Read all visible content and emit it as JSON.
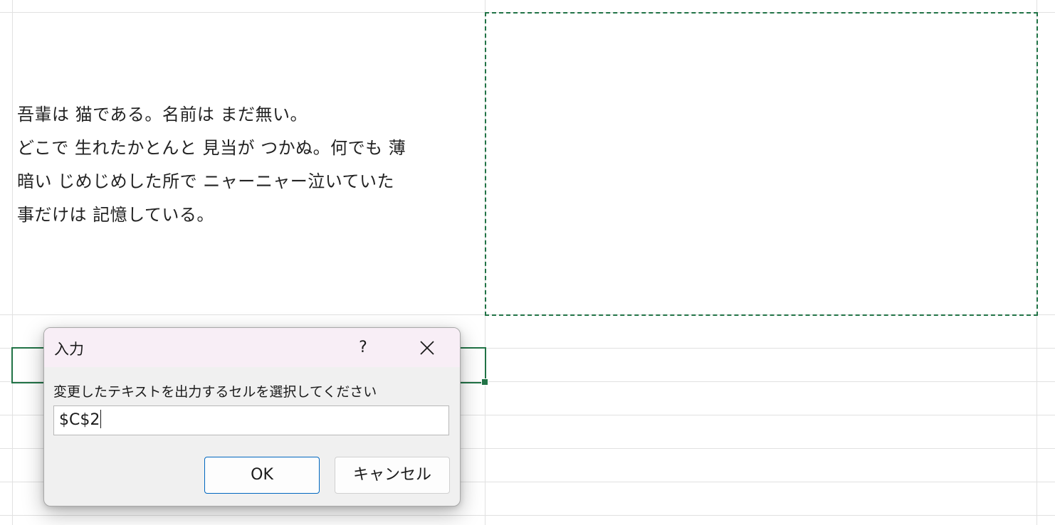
{
  "sheet": {
    "cell_text_lines": [
      "吾輩は 猫である。名前は まだ無い。",
      "どこで 生れたかとんと 見当が つかぬ。何でも 薄",
      "暗い じめじめした所で ニャーニャー泣いていた",
      "事だけは 記憶している。"
    ]
  },
  "dialog": {
    "title": "入力",
    "help_label": "?",
    "prompt": "変更したテキストを出力するセルを選択してください",
    "input_value": "$C$2",
    "ok_label": "OK",
    "cancel_label": "キャンセル",
    "icons": {
      "close": "close-icon"
    }
  },
  "colors": {
    "selection": "#217346",
    "gridline": "#e1e1e1",
    "titlebar": "#f8eef6",
    "ok_border": "#0067c0"
  }
}
